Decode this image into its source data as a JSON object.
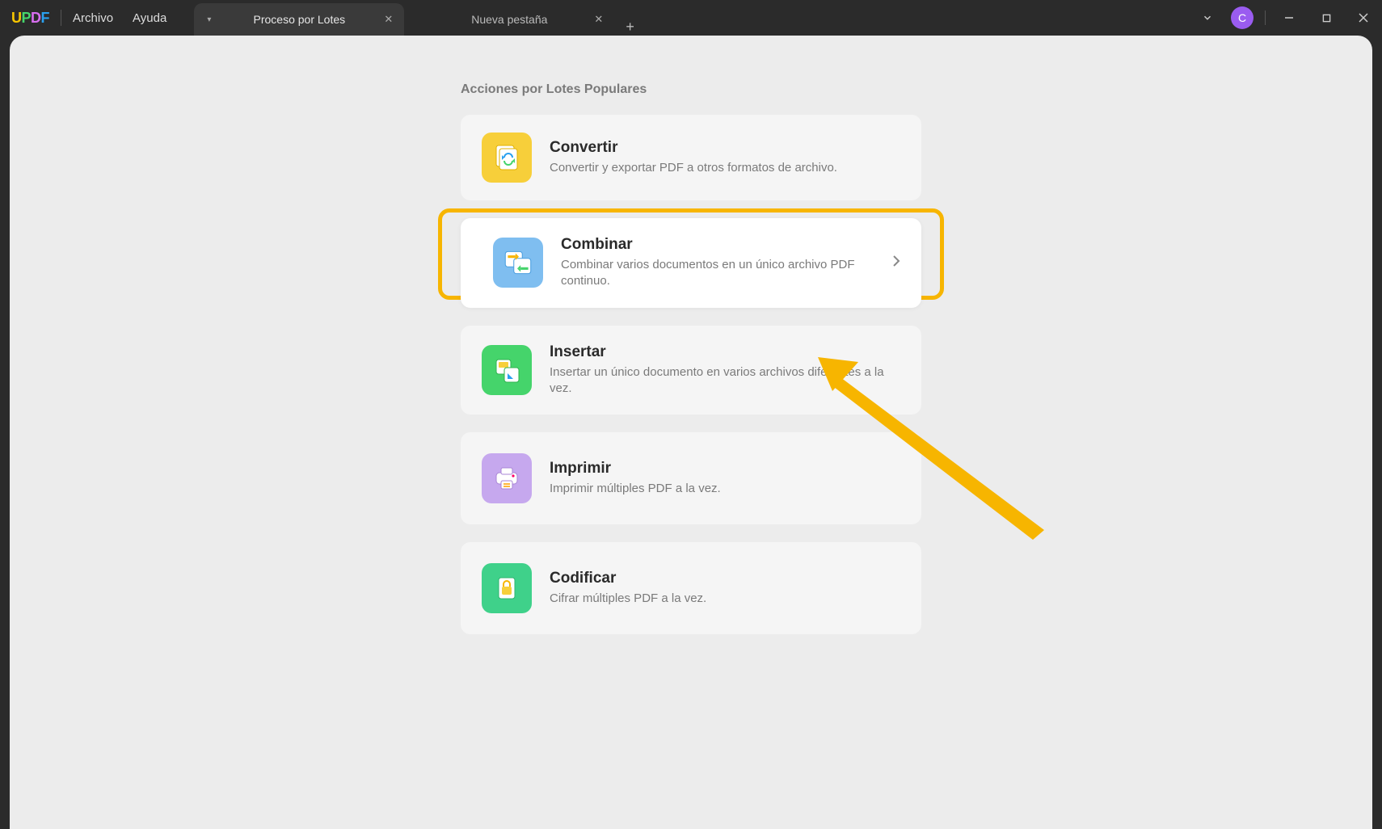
{
  "app": {
    "logo_letters": {
      "u": "U",
      "p": "P",
      "d": "D",
      "f": "F"
    },
    "menu": {
      "archivo": "Archivo",
      "ayuda": "Ayuda"
    },
    "tabs": {
      "active": "Proceso por Lotes",
      "inactive": "Nueva pestaña"
    },
    "avatar_letter": "C"
  },
  "section": {
    "title": "Acciones por Lotes Populares",
    "cards": [
      {
        "title": "Convertir",
        "desc": "Convertir y exportar PDF a otros formatos de archivo."
      },
      {
        "title": "Combinar",
        "desc": "Combinar varios documentos en un único archivo PDF continuo."
      },
      {
        "title": "Insertar",
        "desc": "Insertar un único documento en varios archivos diferentes a la vez."
      },
      {
        "title": "Imprimir",
        "desc": "Imprimir múltiples PDF a la vez."
      },
      {
        "title": "Codificar",
        "desc": "Cifrar múltiples PDF a la vez."
      }
    ]
  }
}
